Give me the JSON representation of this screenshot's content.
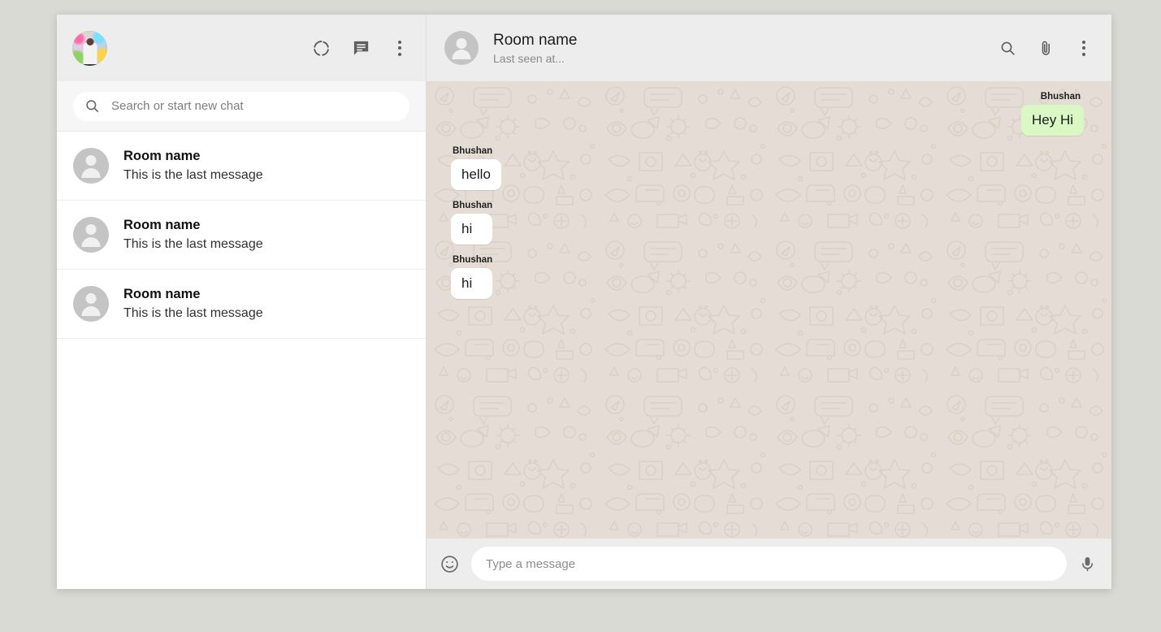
{
  "colors": {
    "page_background": "#dadad4",
    "header_background": "#ededed",
    "panel_background": "#ffffff",
    "chat_background": "#e5ddd5",
    "outgoing_bubble": "#d9f8c4",
    "incoming_bubble": "#ffffff",
    "icon_gray": "#5e5e5e",
    "subtitle_gray": "#8a8a8a"
  },
  "sidebar": {
    "header": {
      "profile_avatar_name": "user-profile-photo",
      "actions": [
        {
          "name": "status-icon",
          "label": "Status"
        },
        {
          "name": "new-chat-icon",
          "label": "New chat"
        },
        {
          "name": "menu-icon",
          "label": "Menu"
        }
      ]
    },
    "search": {
      "icon": "search-icon",
      "placeholder": "Search or start new chat",
      "value": ""
    },
    "chats": [
      {
        "name": "Room name",
        "last_message": "This is the last message",
        "avatar": "person-avatar-icon"
      },
      {
        "name": "Room name",
        "last_message": "This is the last message",
        "avatar": "person-avatar-icon"
      },
      {
        "name": "Room name",
        "last_message": "This is the last message",
        "avatar": "person-avatar-icon"
      }
    ]
  },
  "chat": {
    "header": {
      "avatar": "person-avatar-icon",
      "title": "Room name",
      "subtitle": "Last seen at...",
      "actions": [
        {
          "name": "search-icon",
          "label": "Search"
        },
        {
          "name": "attach-icon",
          "label": "Attach"
        },
        {
          "name": "menu-icon",
          "label": "Menu"
        }
      ]
    },
    "messages": [
      {
        "sender": "Bhushan",
        "text": "Hey Hi",
        "direction": "outgoing"
      },
      {
        "sender": "Bhushan",
        "text": "hello",
        "direction": "incoming"
      },
      {
        "sender": "Bhushan",
        "text": "hi",
        "direction": "incoming"
      },
      {
        "sender": "Bhushan",
        "text": "hi",
        "direction": "incoming"
      }
    ],
    "composer": {
      "emoji_icon": "emoji-icon",
      "placeholder": "Type a message",
      "value": "",
      "mic_icon": "microphone-icon"
    }
  }
}
